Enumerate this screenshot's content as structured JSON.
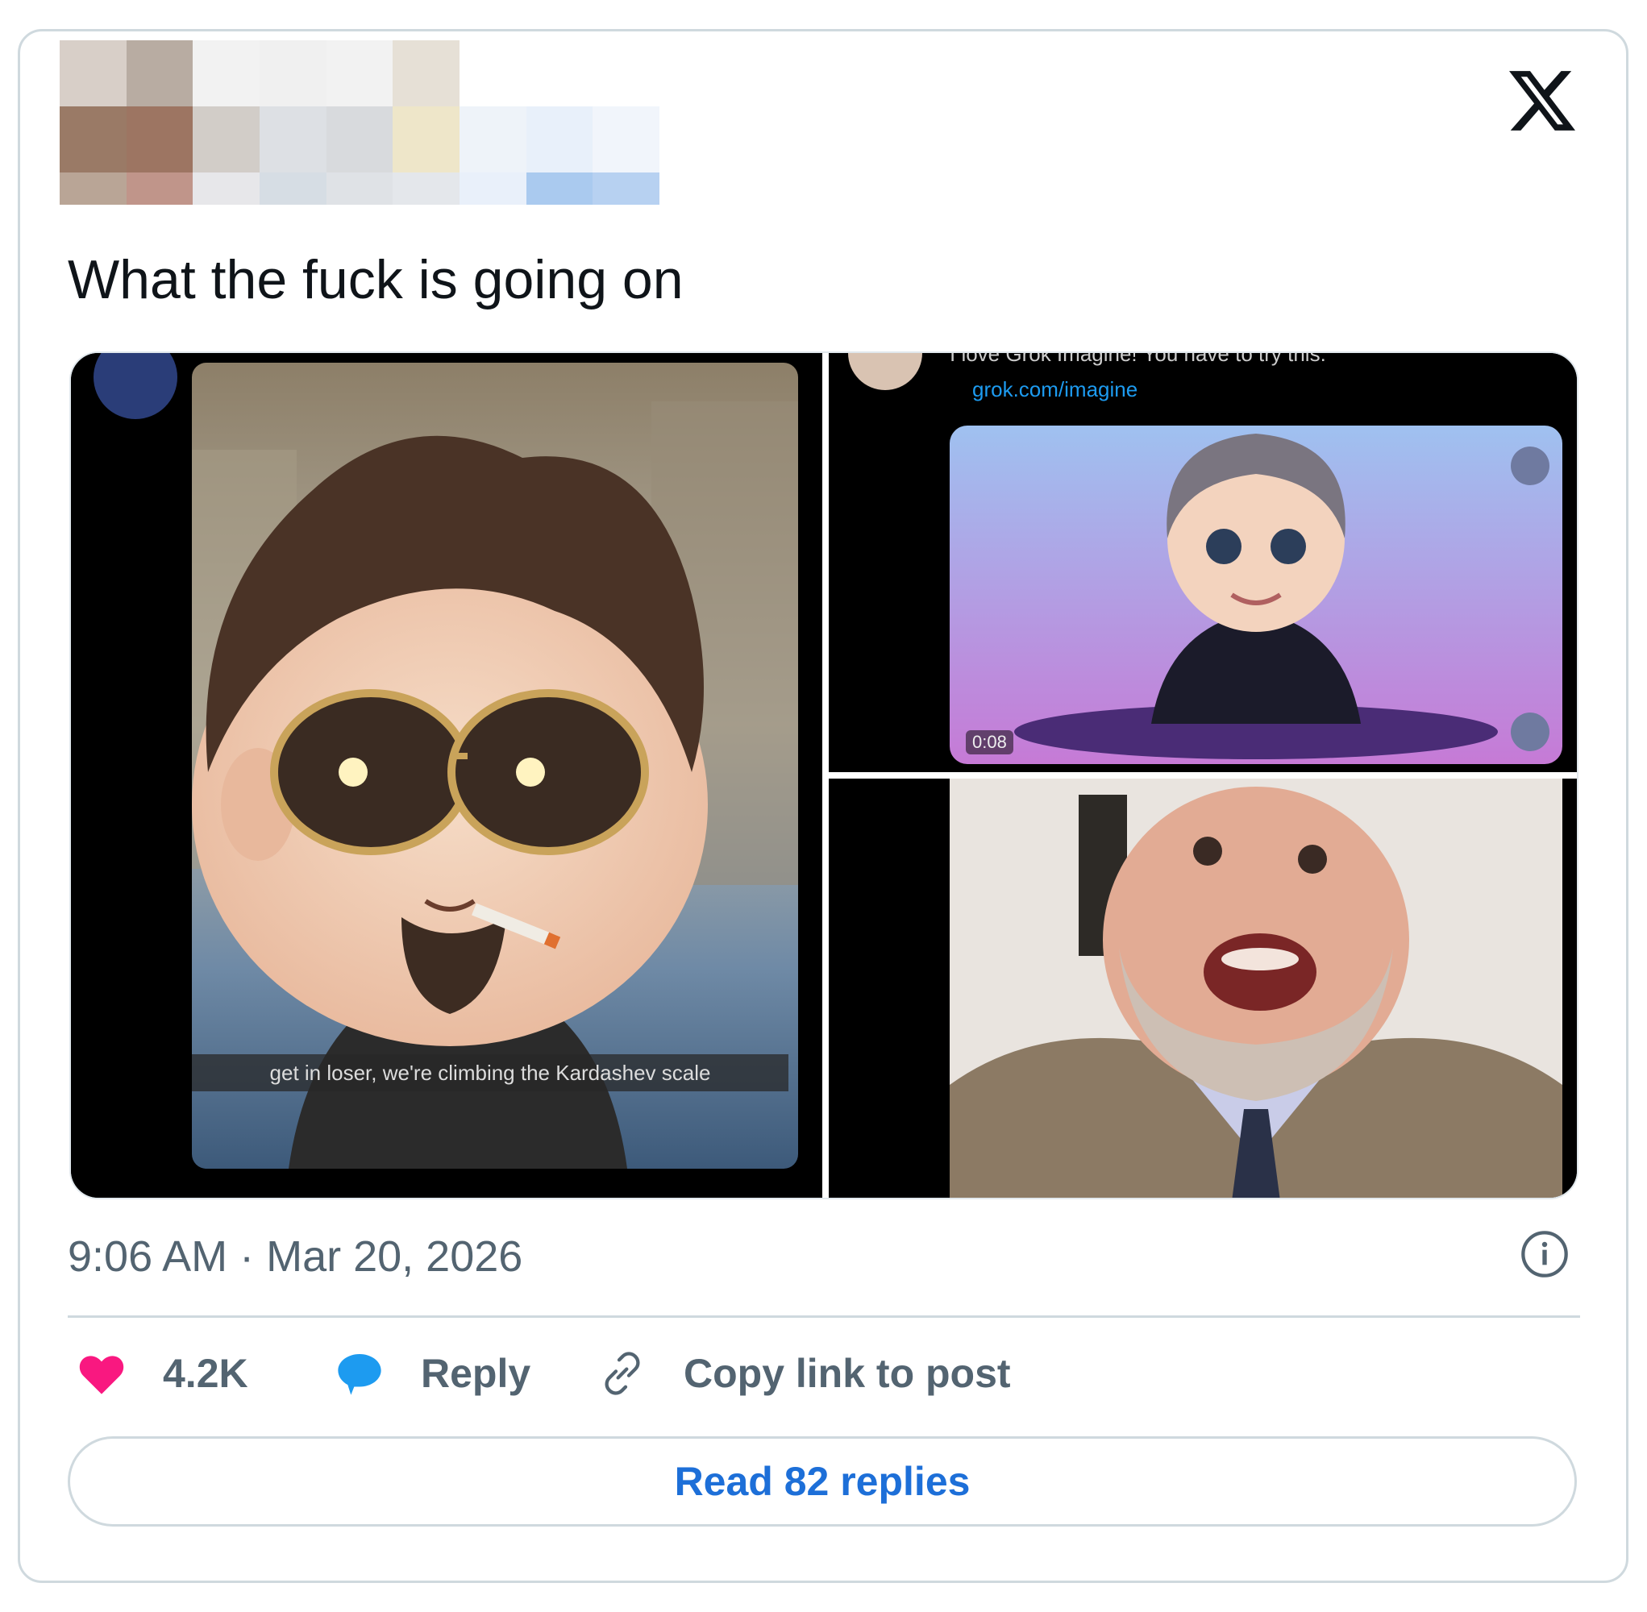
{
  "tweet": {
    "text": "What the fuck is going on",
    "timestamp": "9:06 AM · Mar 20, 2026"
  },
  "media": {
    "left_caption": "get in loser, we're climbing the Kardashev scale",
    "top_right_link": "grok.com/imagine",
    "top_right_partial_text": "I love Grok Imagine! You have to try this:",
    "video_time": "0:08"
  },
  "actions": {
    "likes": "4.2K",
    "reply_label": "Reply",
    "copy_label": "Copy link to post"
  },
  "read_replies_label": "Read 82 replies",
  "icons": {
    "brand": "x-logo-icon",
    "info": "info-icon",
    "like": "heart-icon",
    "reply": "speech-bubble-icon",
    "copy": "link-icon"
  },
  "colors": {
    "like": "#f91880",
    "reply": "#1d9bf0",
    "link_button_text": "#1d6fd8",
    "muted_text": "#536471",
    "border": "#cfd9de"
  }
}
